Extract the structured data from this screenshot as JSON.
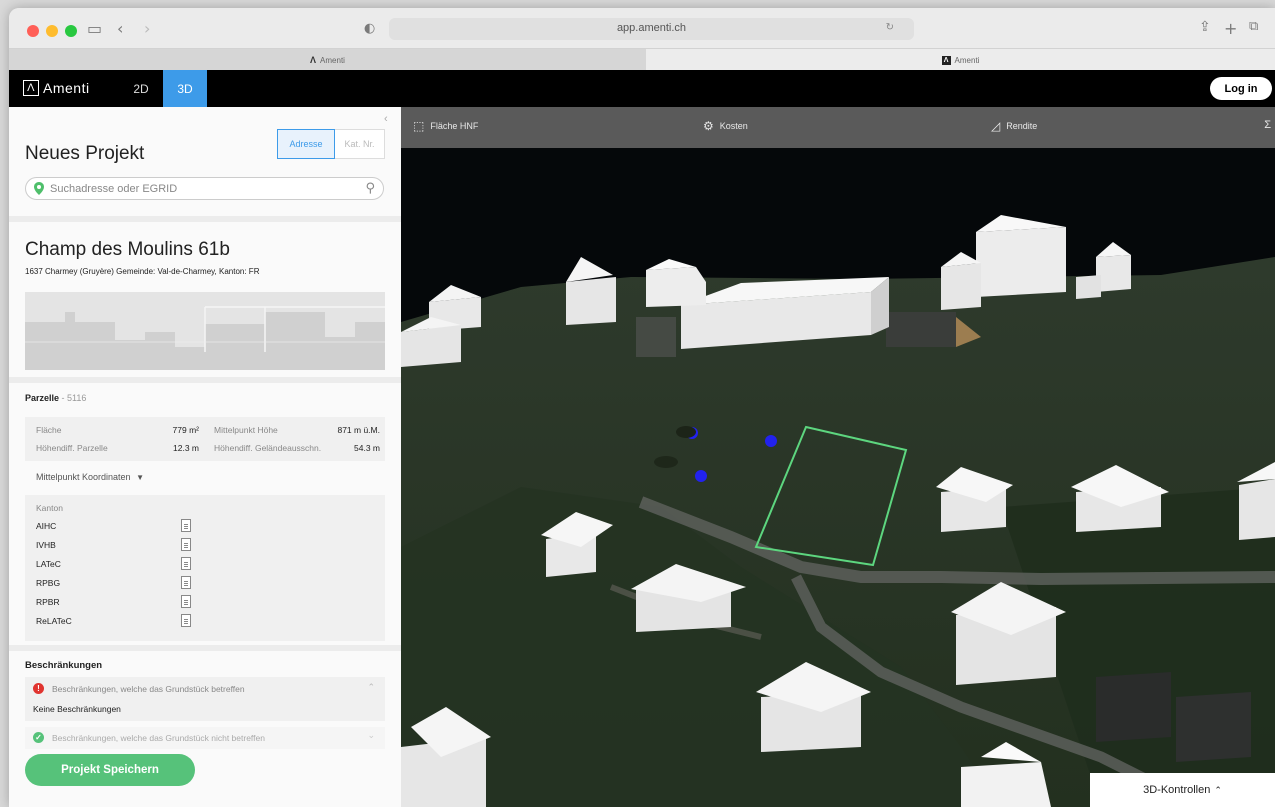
{
  "browser": {
    "url": "app.amenti.ch",
    "tabs": [
      {
        "label": "Amenti"
      },
      {
        "label": "Amenti"
      }
    ]
  },
  "app": {
    "brand": "Amenti",
    "brand_mark": "Λ",
    "modes": [
      "2D",
      "3D"
    ],
    "active_mode": "3D",
    "login_label": "Log in",
    "accent_color": "#3d9be9"
  },
  "sidebar": {
    "title": "Neues Projekt",
    "segment": {
      "active": "Adresse",
      "inactive": "Kat. Nr."
    },
    "search": {
      "placeholder": "Suchadresse oder EGRID"
    },
    "address": {
      "title": "Champ des Moulins 61b",
      "subtitle": "1637 Charmey (Gruyère)   Gemeinde: Val-de-Charmey, Kanton: FR"
    },
    "parcel": {
      "label": "Parzelle",
      "number": "5116",
      "stats": [
        {
          "key": "Fläche",
          "value": "779 m²"
        },
        {
          "key": "Mittelpunkt Höhe",
          "value": "871 m ü.M."
        },
        {
          "key": "Höhendiff. Parzelle",
          "value": "12.3 m"
        },
        {
          "key": "Höhendiff. Geländeausschn.",
          "value": "54.3 m"
        }
      ],
      "coords_label": "Mittelpunkt Koordinaten"
    },
    "kanton": {
      "label": "Kanton",
      "docs": [
        "AIHC",
        "IVHB",
        "LATeC",
        "RPBG",
        "RPBR",
        "ReLATeC"
      ]
    },
    "restrictions": {
      "heading": "Beschränkungen",
      "affecting": "Beschränkungen, welche das Grundstück betreffen",
      "none": "Keine Beschränkungen",
      "not_affecting": "Beschränkungen, welche das Grundstück nicht betreffen"
    },
    "save_label": "Projekt Speichern"
  },
  "map": {
    "toolbar": [
      {
        "label": "Fläche HNF",
        "icon": "area-icon"
      },
      {
        "label": "Kosten",
        "icon": "cost-icon"
      },
      {
        "label": "Rendite",
        "icon": "yield-icon"
      }
    ],
    "sigma": "Σ",
    "controls_label": "3D-Kontrollen",
    "parcel_outline_color": "#5dd67f",
    "marker_color": "#2222ee"
  }
}
